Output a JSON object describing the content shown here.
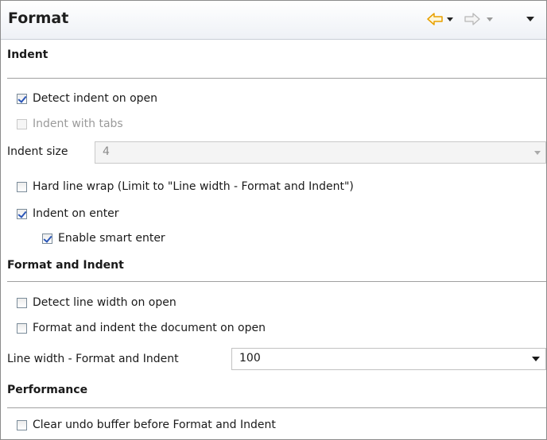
{
  "title": "Format",
  "nav": {
    "back_icon": "arrow-left-icon",
    "back_menu_icon": "chevron-down-icon",
    "forward_icon": "arrow-right-icon",
    "forward_menu_icon": "chevron-down-icon",
    "view_menu_icon": "view-menu-icon"
  },
  "colors": {
    "accent": "#e8a000",
    "check": "#2a56b8"
  },
  "sections": {
    "indent": "Indent",
    "format_indent": "Format and Indent",
    "performance": "Performance"
  },
  "options": {
    "detect_indent": {
      "label": "Detect indent on open",
      "checked": true
    },
    "indent_tabs": {
      "label": "Indent with tabs",
      "checked": false,
      "enabled": false
    },
    "hard_wrap": {
      "label": "Hard line wrap (Limit to \"Line width - Format and Indent\")",
      "checked": false
    },
    "indent_enter": {
      "label": "Indent on enter",
      "checked": true
    },
    "smart_enter": {
      "label": "Enable smart enter",
      "checked": true
    },
    "detect_width": {
      "label": "Detect line width on open",
      "checked": false
    },
    "format_open": {
      "label": "Format and indent the document on open",
      "checked": false
    },
    "clear_undo": {
      "label": "Clear undo buffer before Format and Indent",
      "checked": false
    }
  },
  "indent_size": {
    "label": "Indent size",
    "value": "4"
  },
  "line_width": {
    "label": "Line width - Format and Indent",
    "value": "100"
  }
}
